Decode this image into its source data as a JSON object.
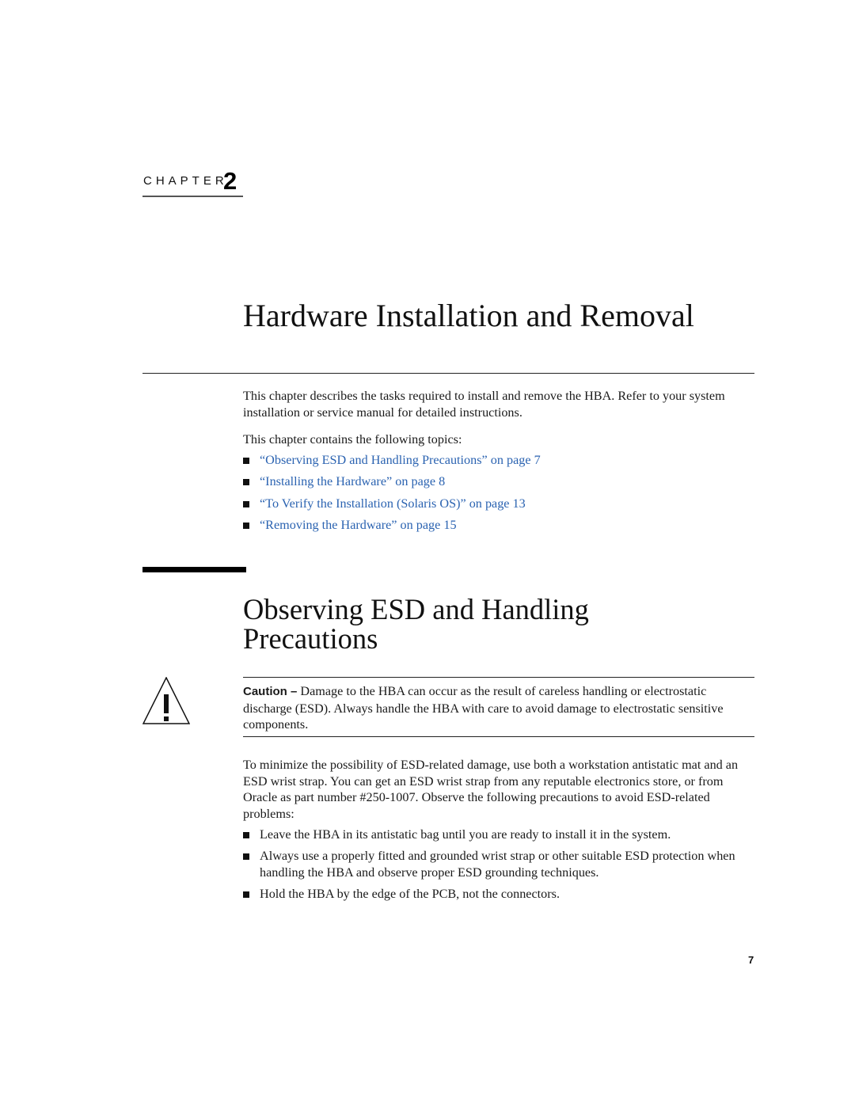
{
  "chapter": {
    "label": "CHAPTER",
    "number": "2"
  },
  "title": "Hardware Installation and Removal",
  "intro": {
    "paragraph": "This chapter describes the tasks required to install and remove the HBA. Refer to your system installation or service manual for detailed instructions.",
    "topics_lead": "This chapter contains the following topics:"
  },
  "topics": [
    {
      "label": "“Observing ESD and Handling Precautions” on page 7"
    },
    {
      "label": "“Installing the Hardware” on page 8"
    },
    {
      "label": "“To Verify the Installation (Solaris OS)” on page 13"
    },
    {
      "label": "“Removing the Hardware” on page 15"
    }
  ],
  "section": {
    "title": "Observing ESD and Handling Precautions",
    "caution": {
      "icon": "warning-triangle-icon",
      "label": "Caution –",
      "text": " Damage to the HBA can occur as the result of careless handling or electrostatic discharge (ESD). Always handle the HBA with care to avoid damage to electrostatic sensitive components."
    },
    "paragraph": "To minimize the possibility of ESD-related damage, use both a workstation antistatic mat and an ESD wrist strap. You can get an ESD wrist strap from any reputable electronics store, or from Oracle as part number #250-1007. Observe the following precautions to avoid ESD-related problems:",
    "precautions": [
      {
        "text": "Leave the HBA in its antistatic bag until you are ready to install it in the system."
      },
      {
        "text": "Always use a properly fitted and grounded wrist strap or other suitable ESD protection when handling the HBA and observe proper ESD grounding techniques."
      },
      {
        "text": "Hold the HBA by the edge of the PCB, not the connectors."
      }
    ]
  },
  "page_number": "7",
  "colors": {
    "link": "#2b63b1",
    "text": "#1a1a1a"
  }
}
